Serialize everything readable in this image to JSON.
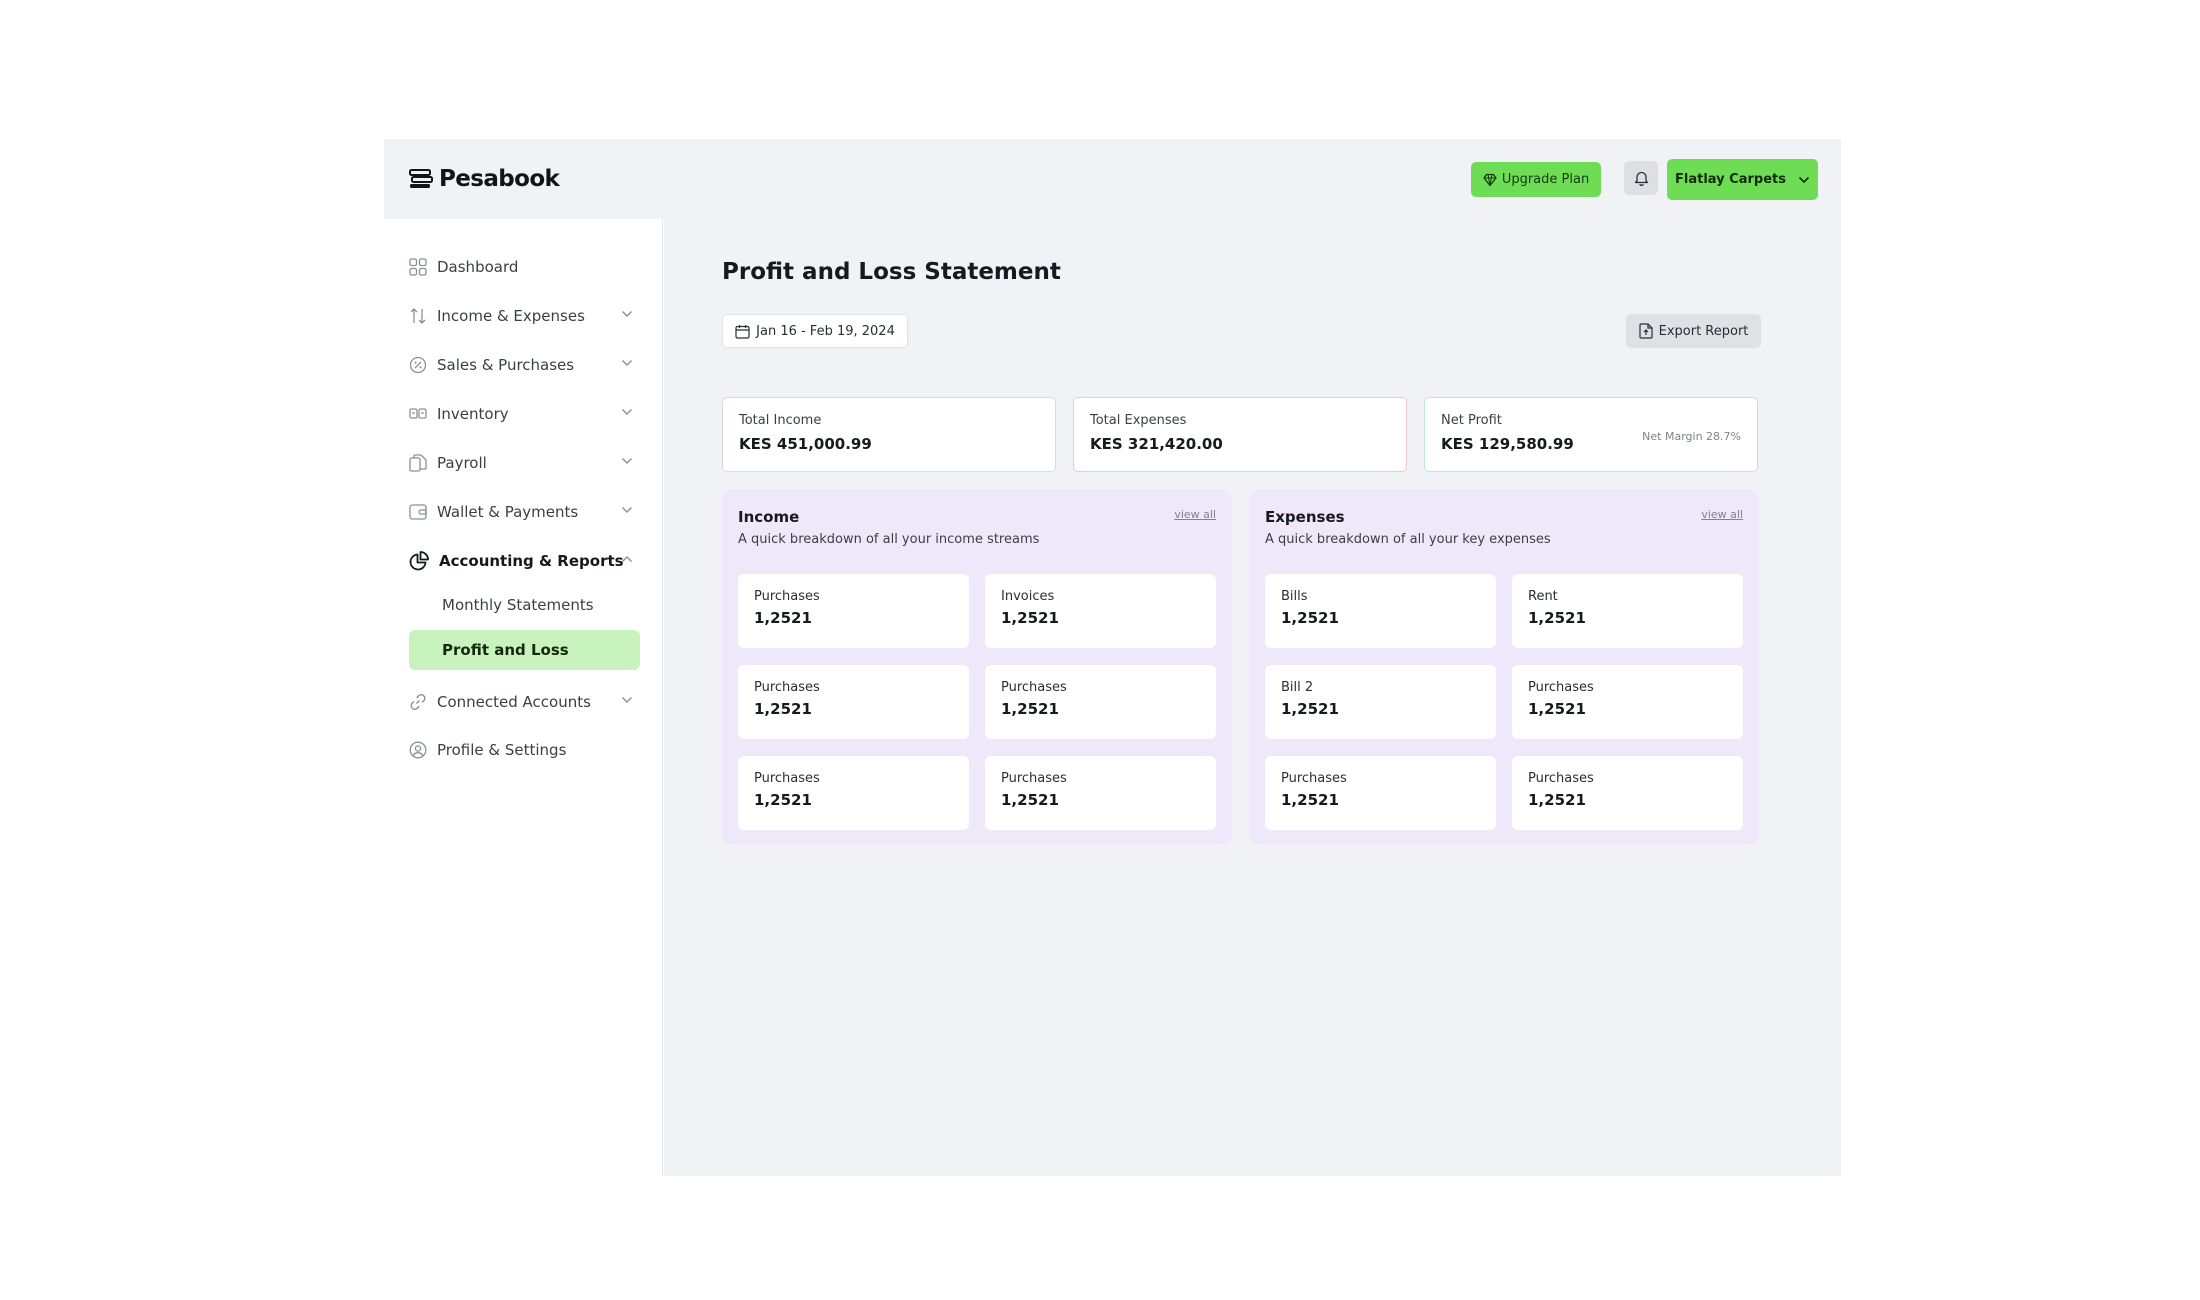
{
  "brand": {
    "name": "Pesabook"
  },
  "header": {
    "upgrade_label": "Upgrade Plan",
    "company_label": "Flatlay Carpets"
  },
  "sidebar": {
    "items": [
      {
        "label": "Dashboard",
        "icon": "grid-icon"
      },
      {
        "label": "Income & Expenses",
        "icon": "arrows-updown-icon"
      },
      {
        "label": "Sales & Purchases",
        "icon": "tag-circle-icon"
      },
      {
        "label": "Inventory",
        "icon": "inventory-icon"
      },
      {
        "label": "Payroll",
        "icon": "documents-icon"
      },
      {
        "label": "Wallet & Payments",
        "icon": "wallet-icon"
      },
      {
        "label": "Accounting & Reports",
        "icon": "pie-chart-icon"
      },
      {
        "label": "Connected Accounts",
        "icon": "link-icon"
      },
      {
        "label": "Profile & Settings",
        "icon": "user-circle-icon"
      }
    ],
    "subitems": [
      {
        "label": "Monthly Statements"
      },
      {
        "label": "Profit and Loss"
      }
    ]
  },
  "main": {
    "title": "Profit and Loss Statement",
    "date_range": "Jan 16 - Feb 19, 2024",
    "export_label": "Export Report",
    "stats": [
      {
        "label": "Total Income",
        "value": "KES 451,000.99"
      },
      {
        "label": "Total Expenses",
        "value": "KES 321,420.00"
      },
      {
        "label": "Net Profit",
        "value": "KES 129,580.99",
        "note": "Net Margin 28.7%"
      }
    ],
    "income": {
      "title": "Income",
      "subtitle": "A quick breakdown of all your income streams",
      "view_all": "view all",
      "tiles": [
        {
          "label": "Purchases",
          "value": "1,2521"
        },
        {
          "label": "Invoices",
          "value": "1,2521"
        },
        {
          "label": "Purchases",
          "value": "1,2521"
        },
        {
          "label": "Purchases",
          "value": "1,2521"
        },
        {
          "label": "Purchases",
          "value": "1,2521"
        },
        {
          "label": "Purchases",
          "value": "1,2521"
        }
      ]
    },
    "expenses": {
      "title": "Expenses",
      "subtitle": "A quick breakdown of all your key expenses",
      "view_all": "view all",
      "tiles": [
        {
          "label": "Bills",
          "value": "1,2521"
        },
        {
          "label": "Rent",
          "value": "1,2521"
        },
        {
          "label": "Bill 2",
          "value": "1,2521"
        },
        {
          "label": "Purchases",
          "value": "1,2521"
        },
        {
          "label": "Purchases",
          "value": "1,2521"
        },
        {
          "label": "Purchases",
          "value": "1,2521"
        }
      ]
    }
  },
  "colors": {
    "accent_green": "#6fdc56",
    "selected_green": "#c9f3bd",
    "panel_lavender": "#efe8fb",
    "expense_border": "#f2c9c9",
    "profit_border": "#bfe9c8"
  }
}
